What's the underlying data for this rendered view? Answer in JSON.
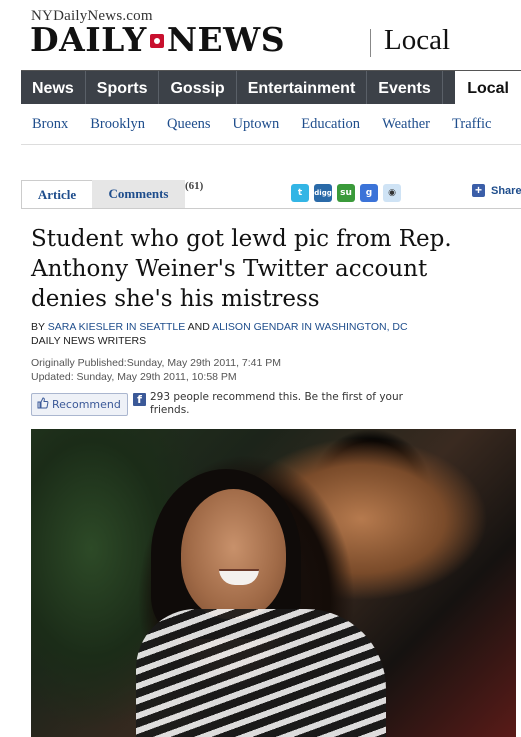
{
  "masthead": {
    "site_url": "NYDailyNews.com",
    "logo_left": "DAILY",
    "logo_right": "NEWS",
    "section": "Local"
  },
  "nav_main": [
    "News",
    "Sports",
    "Gossip",
    "Entertainment",
    "Events",
    "Local"
  ],
  "nav_main_active": "Local",
  "nav_sub": [
    "Bronx",
    "Brooklyn",
    "Queens",
    "Uptown",
    "Education",
    "Weather",
    "Traffic"
  ],
  "tabs": {
    "article": "Article",
    "comments": "Comments",
    "comments_count": "(61)"
  },
  "social": {
    "icons": [
      "twitter-icon",
      "digg-icon",
      "stumbleupon-icon",
      "google-icon",
      "reddit-icon"
    ],
    "share_label": "Share"
  },
  "article": {
    "headline": "Student who got lewd pic from Rep. Anthony Weiner's Twitter account denies she's his mistress",
    "byline_prefix": "BY",
    "author_1": "SARA KIESLER IN SEATTLE",
    "byline_and": "AND",
    "author_2": "ALISON GENDAR IN WASHINGTON, DC",
    "publication": "DAILY NEWS WRITERS",
    "published": "Originally Published:Sunday, May 29th 2011, 7:41 PM",
    "updated": "Updated: Sunday, May 29th 2011, 10:58 PM"
  },
  "facebook": {
    "recommend_label": "Recommend",
    "recommend_text": "293 people recommend this. Be the first of your friends."
  },
  "colors": {
    "nav_bg": "#3c4148",
    "link": "#1e4d8c",
    "logo_red": "#c8102e",
    "facebook": "#3b5998"
  }
}
